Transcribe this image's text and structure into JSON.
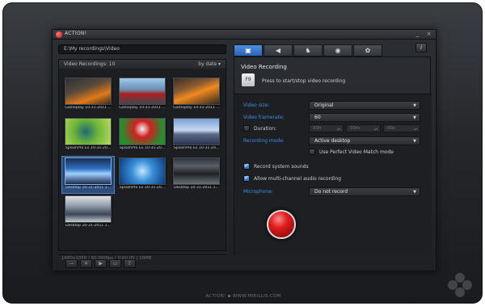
{
  "app": {
    "title": "ACTION!",
    "footer": "ACTION!  ▪  WWW.MIRILLIS.COM",
    "help_label": "i"
  },
  "window_controls": {
    "minimize": "_",
    "close": "×"
  },
  "left": {
    "path": "E:\\My recordings\\Video",
    "list_title": "Video Recordings: 10",
    "sort": "by date",
    "sort_arrow": "▾",
    "status": "1680x1050 | 60.000fps | 0:00:05 | 10MB",
    "thumbnails": [
      {
        "caption": "Gameplay 10-31-2011 ..."
      },
      {
        "caption": "Gameplay 10-31-2011 ..."
      },
      {
        "caption": "Gameplay 10-31-2011 ..."
      },
      {
        "caption": "SplashPro Ex 10-31-20..."
      },
      {
        "caption": "SplashPro Ex 10-31-20..."
      },
      {
        "caption": "SplashPro Ex 10-31-20..."
      },
      {
        "caption": "Desktop 10-31-2011 1..."
      },
      {
        "caption": "SplashPro Ex 10-31-20..."
      },
      {
        "caption": "Desktop 10-31-2011 1..."
      },
      {
        "caption": "Desktop 10-31-2011 1..."
      }
    ],
    "buttons": [
      "—",
      "✕",
      "▶",
      "▭",
      "⇪"
    ]
  },
  "tabs": [
    "▣",
    "◀",
    "♞",
    "◉",
    "✿"
  ],
  "right": {
    "title": "Video Recording",
    "hotkey": "F9",
    "hotkey_text": "Press to start/stop video recording",
    "video_size_label": "Video size:",
    "video_size": "Original",
    "framerate_label": "Video framerate:",
    "framerate": "60",
    "duration_label": "Duration:",
    "duration_h": "00h",
    "duration_m": "00m",
    "duration_s": "00s",
    "mode_label": "Recording mode:",
    "mode": "Active desktop",
    "perfect_match": "Use Perfect Video Match mode",
    "system_sounds": "Record system sounds",
    "multichannel": "Allow multi-channel audio recording",
    "mic_label": "Microphone:",
    "mic": "Do not record",
    "dropdown_arrow": "▼",
    "spin": "▴▾"
  }
}
